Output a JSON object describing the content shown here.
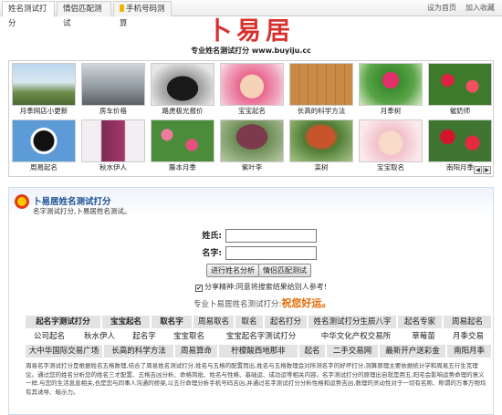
{
  "tabs": [
    {
      "label": "姓名测试打分"
    },
    {
      "label": "情侣匹配测试"
    },
    {
      "label": "手机号码测算"
    }
  ],
  "top_links": {
    "homepage": "设为首页",
    "bookmark": "加入收藏"
  },
  "site": {
    "logo_text": "卜易居",
    "slogan": "专业姓名测试打分 www.buyiju.cc"
  },
  "gallery": [
    {
      "caption": "月季网店小更新",
      "icon": "pagoda-photo"
    },
    {
      "caption": "房车价格",
      "icon": "rv-photo"
    },
    {
      "caption": "路虎极光报价",
      "icon": "suv-photo"
    },
    {
      "caption": "宝宝起名",
      "icon": "baby-photo"
    },
    {
      "caption": "长高的科学方法",
      "icon": "floor-photo"
    },
    {
      "caption": "月季树",
      "icon": "rose-tree-photo"
    },
    {
      "caption": "催奶师",
      "icon": "flowers-photo"
    },
    {
      "caption": "周易起名",
      "icon": "yin-yang-photo"
    },
    {
      "caption": "秋水伊人",
      "icon": "fashion-photo"
    },
    {
      "caption": "藤本月季",
      "icon": "climbing-rose-photo"
    },
    {
      "caption": "紫叶李",
      "icon": "plum-tree-photo"
    },
    {
      "caption": "栾树",
      "icon": "tree-photo"
    },
    {
      "caption": "宝宝取名",
      "icon": "baby-photo"
    },
    {
      "caption": "南阳月季",
      "icon": "red-rose-photo"
    }
  ],
  "panel": {
    "title": "卜易居姓名测试打分",
    "subtitle": "名字测试打分,卜易居姓名测试。",
    "surname_label": "姓氏:",
    "surname_value": "",
    "name_label": "名字:",
    "name_value": "",
    "analyze_button": "进行姓名分析",
    "match_button": "情侣匹配测试",
    "share_text": "分享精神:同意将搜索结果给别人参考!",
    "share_checked": true,
    "recommend_prefix": "专业卜易居姓名测试打分:",
    "recommend_wish": "祝您好运。"
  },
  "keywords": [
    [
      "起名字测试打分",
      "宝宝起名",
      "取名字",
      "周易取名",
      "取名",
      "起名打分",
      "姓名测试打分生辰八字",
      "起名专家",
      "周易起名"
    ],
    [
      "公司起名",
      "秋水伊人",
      "起名字",
      "宝宝取名",
      "宝宝起名字测试打分",
      "中华文化产权交易所",
      "草莓苗",
      "月季交易"
    ],
    [
      "大中华国际交易广场",
      "长高的科学方法",
      "周易算命",
      "柠檬酸西地那非",
      "起名",
      "二手交易网",
      "最新开户送彩金",
      "南阳月季"
    ]
  ],
  "description": "周易名字测试打分是根据姓名五格数理,结合了周易姓名测试打分,姓名与五格的配置而出,姓名与五格数理会对所测名字的好坏打分,测算原理主要依据统计学和周易五行生克理论。通过您的姓名分析您的姓名三才配置、五格吉凶分析、命格简批、姓名与性格、基础运、成功运等相关内容。名字测试打分的原理出自就是用五,阳宅会影响运势命理的意义一样,与您的生活息息相关,也是您与同事人沟通的桥梁,以五行命理分析手机号码吉凶,并通过名字测试打分分析性格和运势吉凶,数理的灵动性对于一切有名称、称谓的万事万物均有其诱导、暗示力。"
}
